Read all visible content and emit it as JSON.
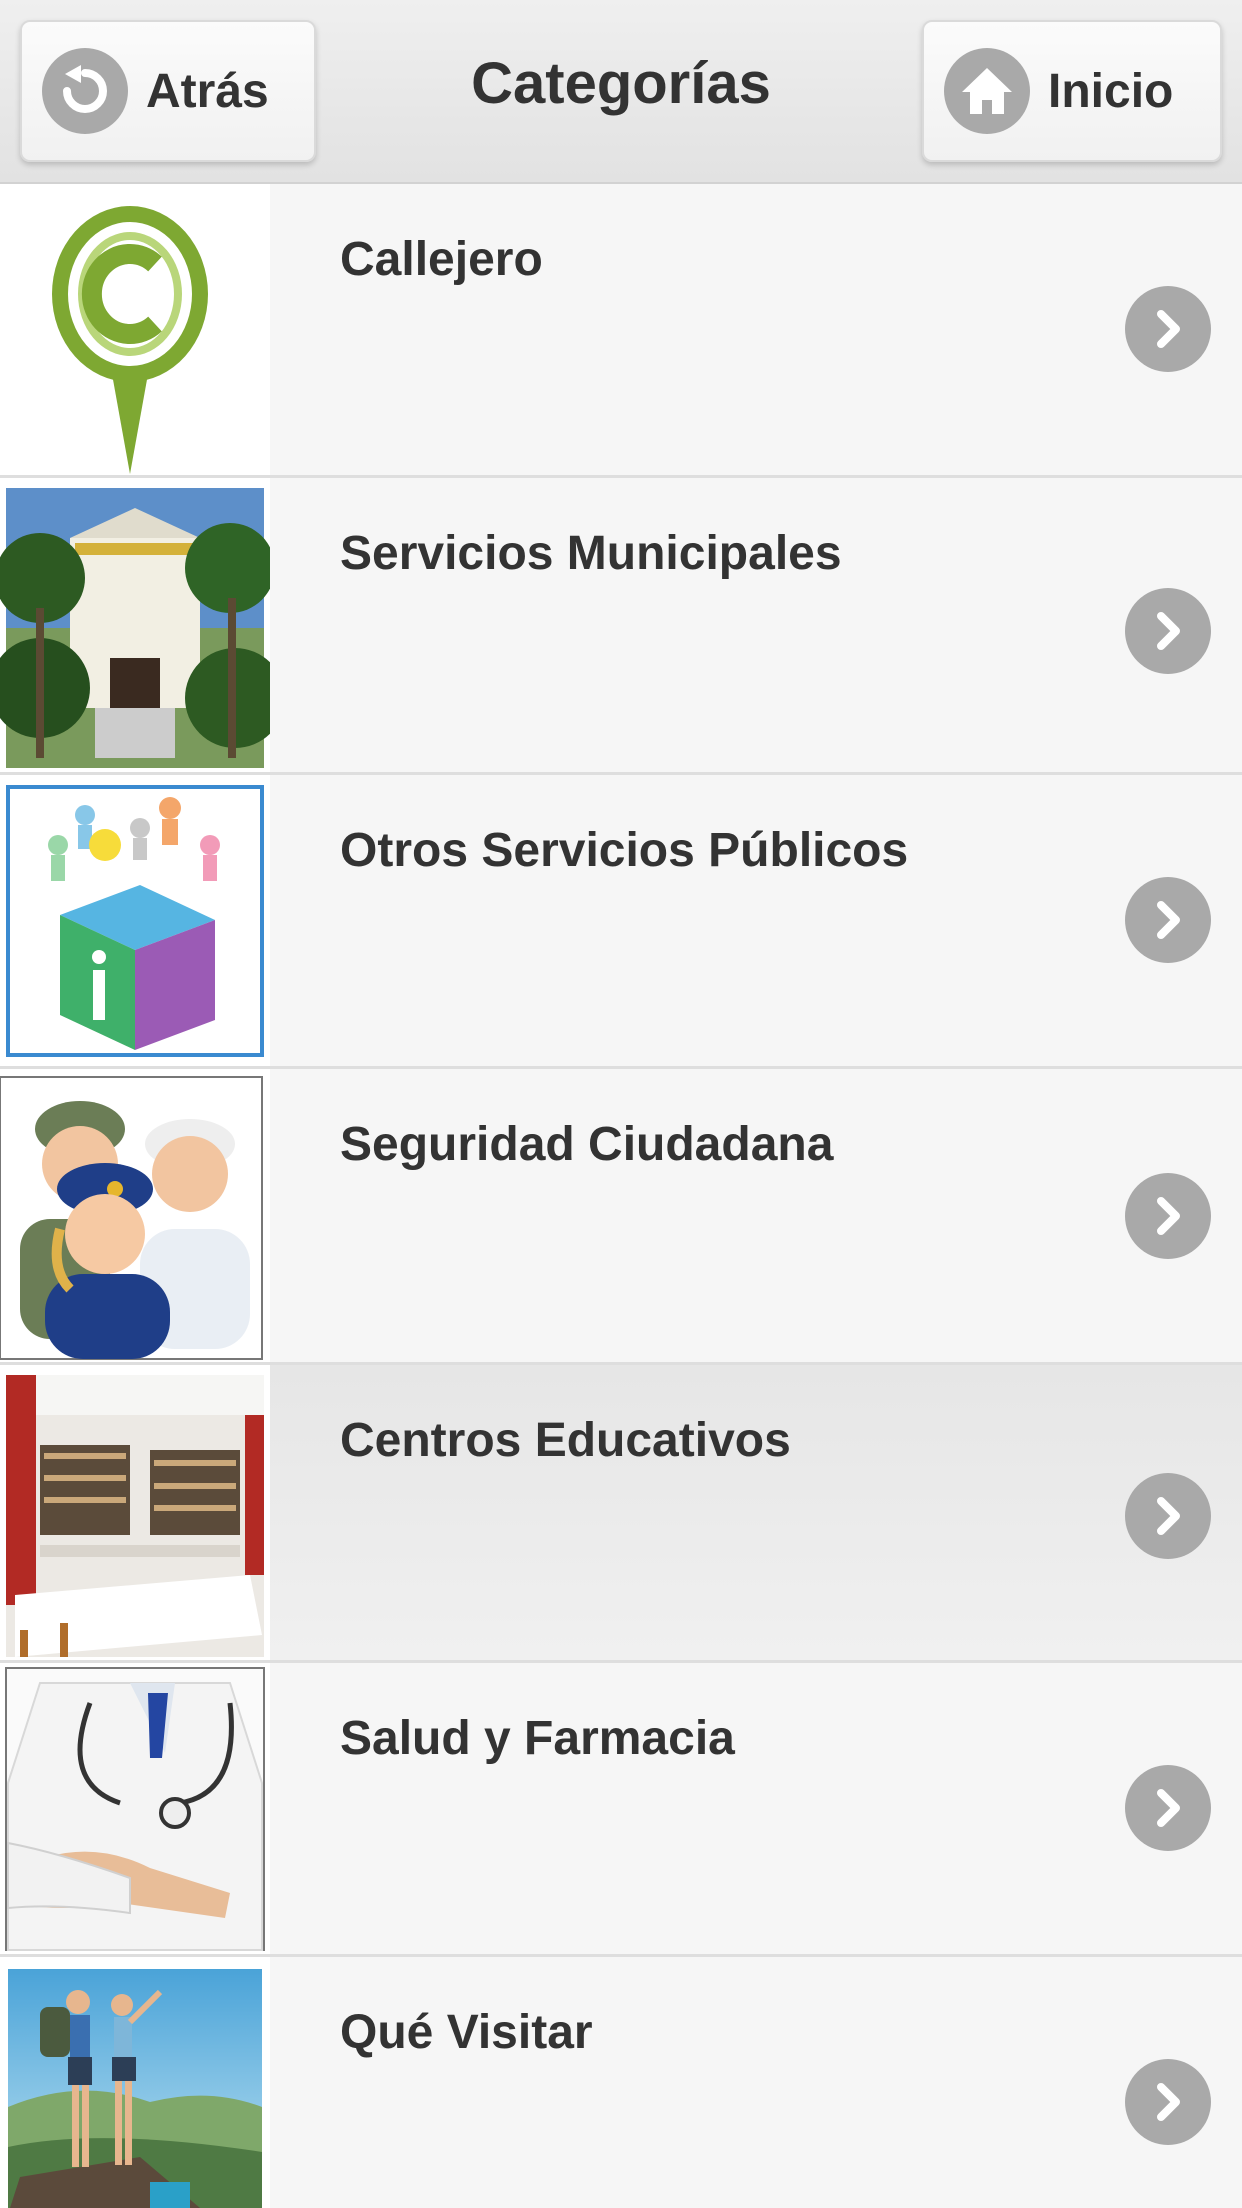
{
  "header": {
    "back_label": "Atrás",
    "title": "Categorías",
    "home_label": "Inicio"
  },
  "categories": [
    {
      "label": "Callejero",
      "icon": "map-pin-c-icon"
    },
    {
      "label": "Servicios Municipales",
      "icon": "town-hall-photo"
    },
    {
      "label": "Otros Servicios Públicos",
      "icon": "info-cube-icon"
    },
    {
      "label": "Seguridad Ciudadana",
      "icon": "security-people-icon"
    },
    {
      "label": "Centros Educativos",
      "icon": "library-photo"
    },
    {
      "label": "Salud y Farmacia",
      "icon": "doctor-photo"
    },
    {
      "label": "Qué Visitar",
      "icon": "hikers-photo"
    }
  ],
  "colors": {
    "header_bg": "#e6e6e6",
    "icon_circle": "#a9a9a9",
    "row_bg": "#f6f6f6",
    "active_row_bg": "#ebebeb",
    "pin_green": "#7ea832"
  }
}
